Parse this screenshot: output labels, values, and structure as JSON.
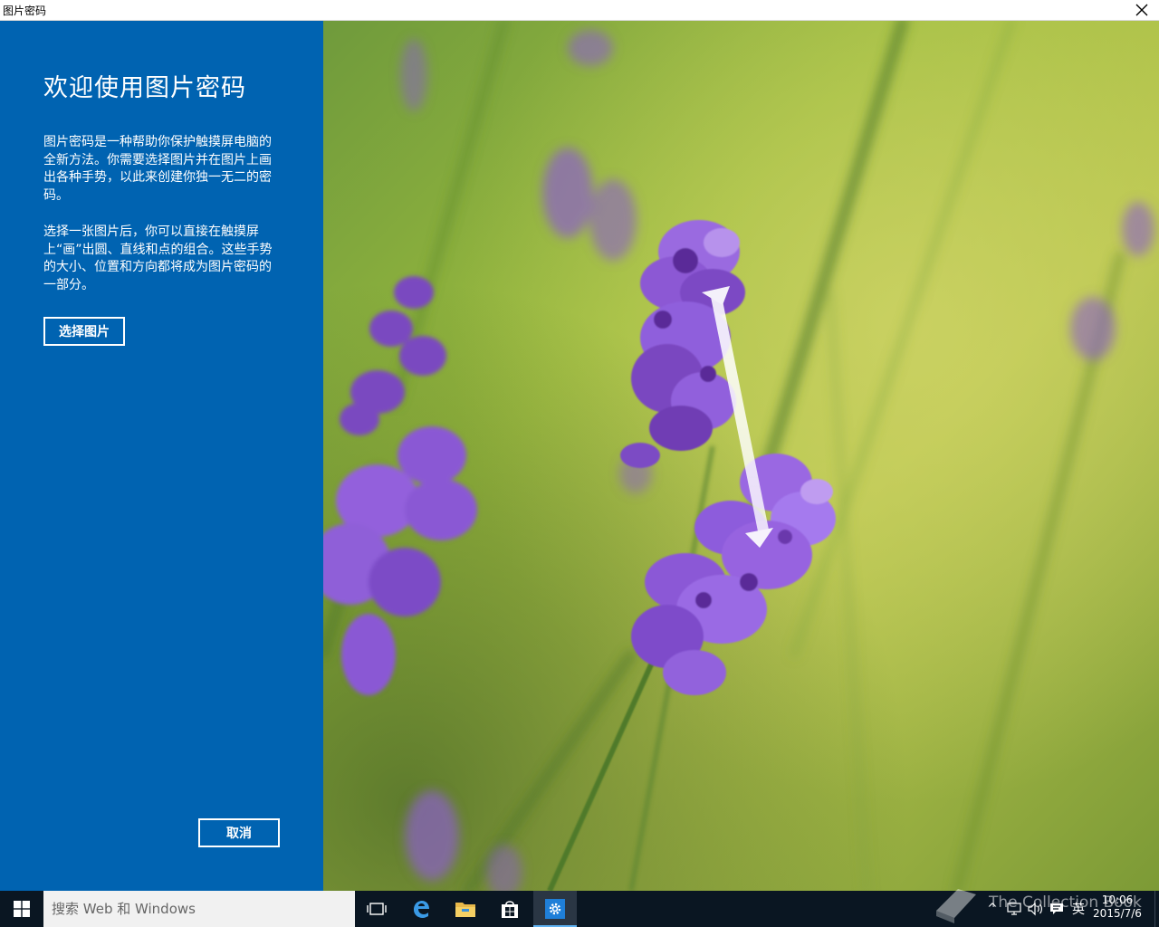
{
  "window": {
    "title": "图片密码",
    "close_icon": "close-icon"
  },
  "panel": {
    "heading": "欢迎使用图片密码",
    "paragraph1": "图片密码是一种帮助你保护触摸屏电脑的全新方法。你需要选择图片并在图片上画出各种手势，以此来创建你独一无二的密码。",
    "paragraph2": "选择一张图片后，你可以直接在触摸屏上“画”出圆、直线和点的组合。这些手势的大小、位置和方向都将成为图片密码的一部分。",
    "choose_picture_label": "选择图片",
    "cancel_label": "取消",
    "background_color": "#0063b1"
  },
  "picture": {
    "subject": "lavender flowers",
    "gesture": "double-arrow"
  },
  "taskbar": {
    "search_placeholder": "搜索 Web 和 Windows",
    "icons": [
      "windows-logo-icon",
      "task-view-icon",
      "edge-icon",
      "file-explorer-icon",
      "store-icon",
      "settings-icon"
    ],
    "tray": {
      "chevron": "^",
      "ime": "英",
      "time": "10:06",
      "date": "2015/7/6"
    },
    "watermark": "The Collection Book"
  }
}
